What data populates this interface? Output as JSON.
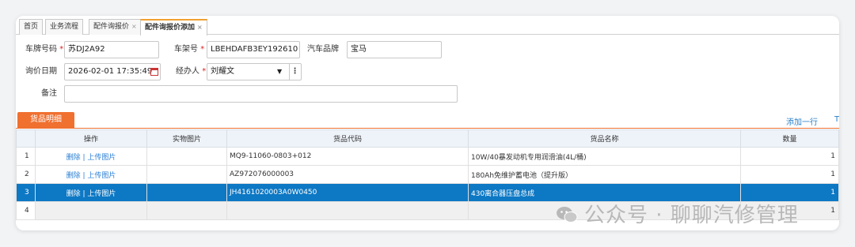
{
  "tabs": [
    {
      "label": "首页",
      "closable": false
    },
    {
      "label": "业务流程",
      "closable": false
    },
    {
      "label": "配件询报价",
      "closable": true
    },
    {
      "label": "配件询报价添加",
      "closable": true
    }
  ],
  "tab_close_glyph": "×",
  "required_mark": "*",
  "form": {
    "plate_label": "车牌号码",
    "plate_value": "苏DJ2A92",
    "vin_label": "车架号",
    "vin_value": "LBEHDAFB3EY192610",
    "brand_label": "汽车品牌",
    "brand_value": "宝马",
    "date_label": "询价日期",
    "date_value": "2026-02-01 17:35:49",
    "handler_label": "经办人",
    "handler_value": "刘耀文",
    "remark_label": "备注",
    "remark_value": ""
  },
  "section": {
    "tab_label": "货品明细",
    "add_row_label": "添加一行",
    "cut_link_label": "T"
  },
  "grid": {
    "columns": [
      "",
      "操作",
      "实物图片",
      "货品代码",
      "货品名称",
      "数量"
    ],
    "delete_label": "删除",
    "separator": "|",
    "upload_label": "上传图片",
    "rows": [
      {
        "no": "1",
        "code": "MQ9-11060-0803+012",
        "name": "10W/40暴发动机专用润滑油(4L/桶)",
        "qty": "1",
        "selected": false
      },
      {
        "no": "2",
        "code": "AZ972076000003",
        "name": "180Ah免维护蓄电池（提升版）",
        "qty": "1",
        "selected": false
      },
      {
        "no": "3",
        "code": "JH4161020003A0W0450",
        "name": "430离合器压盘总成",
        "qty": "1",
        "selected": true
      },
      {
        "no": "4",
        "code": "",
        "name": "",
        "qty": "1",
        "selected": false,
        "empty": true
      }
    ]
  },
  "watermark": "公众号 · 聊聊汽修管理",
  "colors": {
    "accent_orange": "#f07030",
    "selected_row": "#0d78c4",
    "link_blue": "#2a80c8",
    "required_red": "#e02020"
  }
}
